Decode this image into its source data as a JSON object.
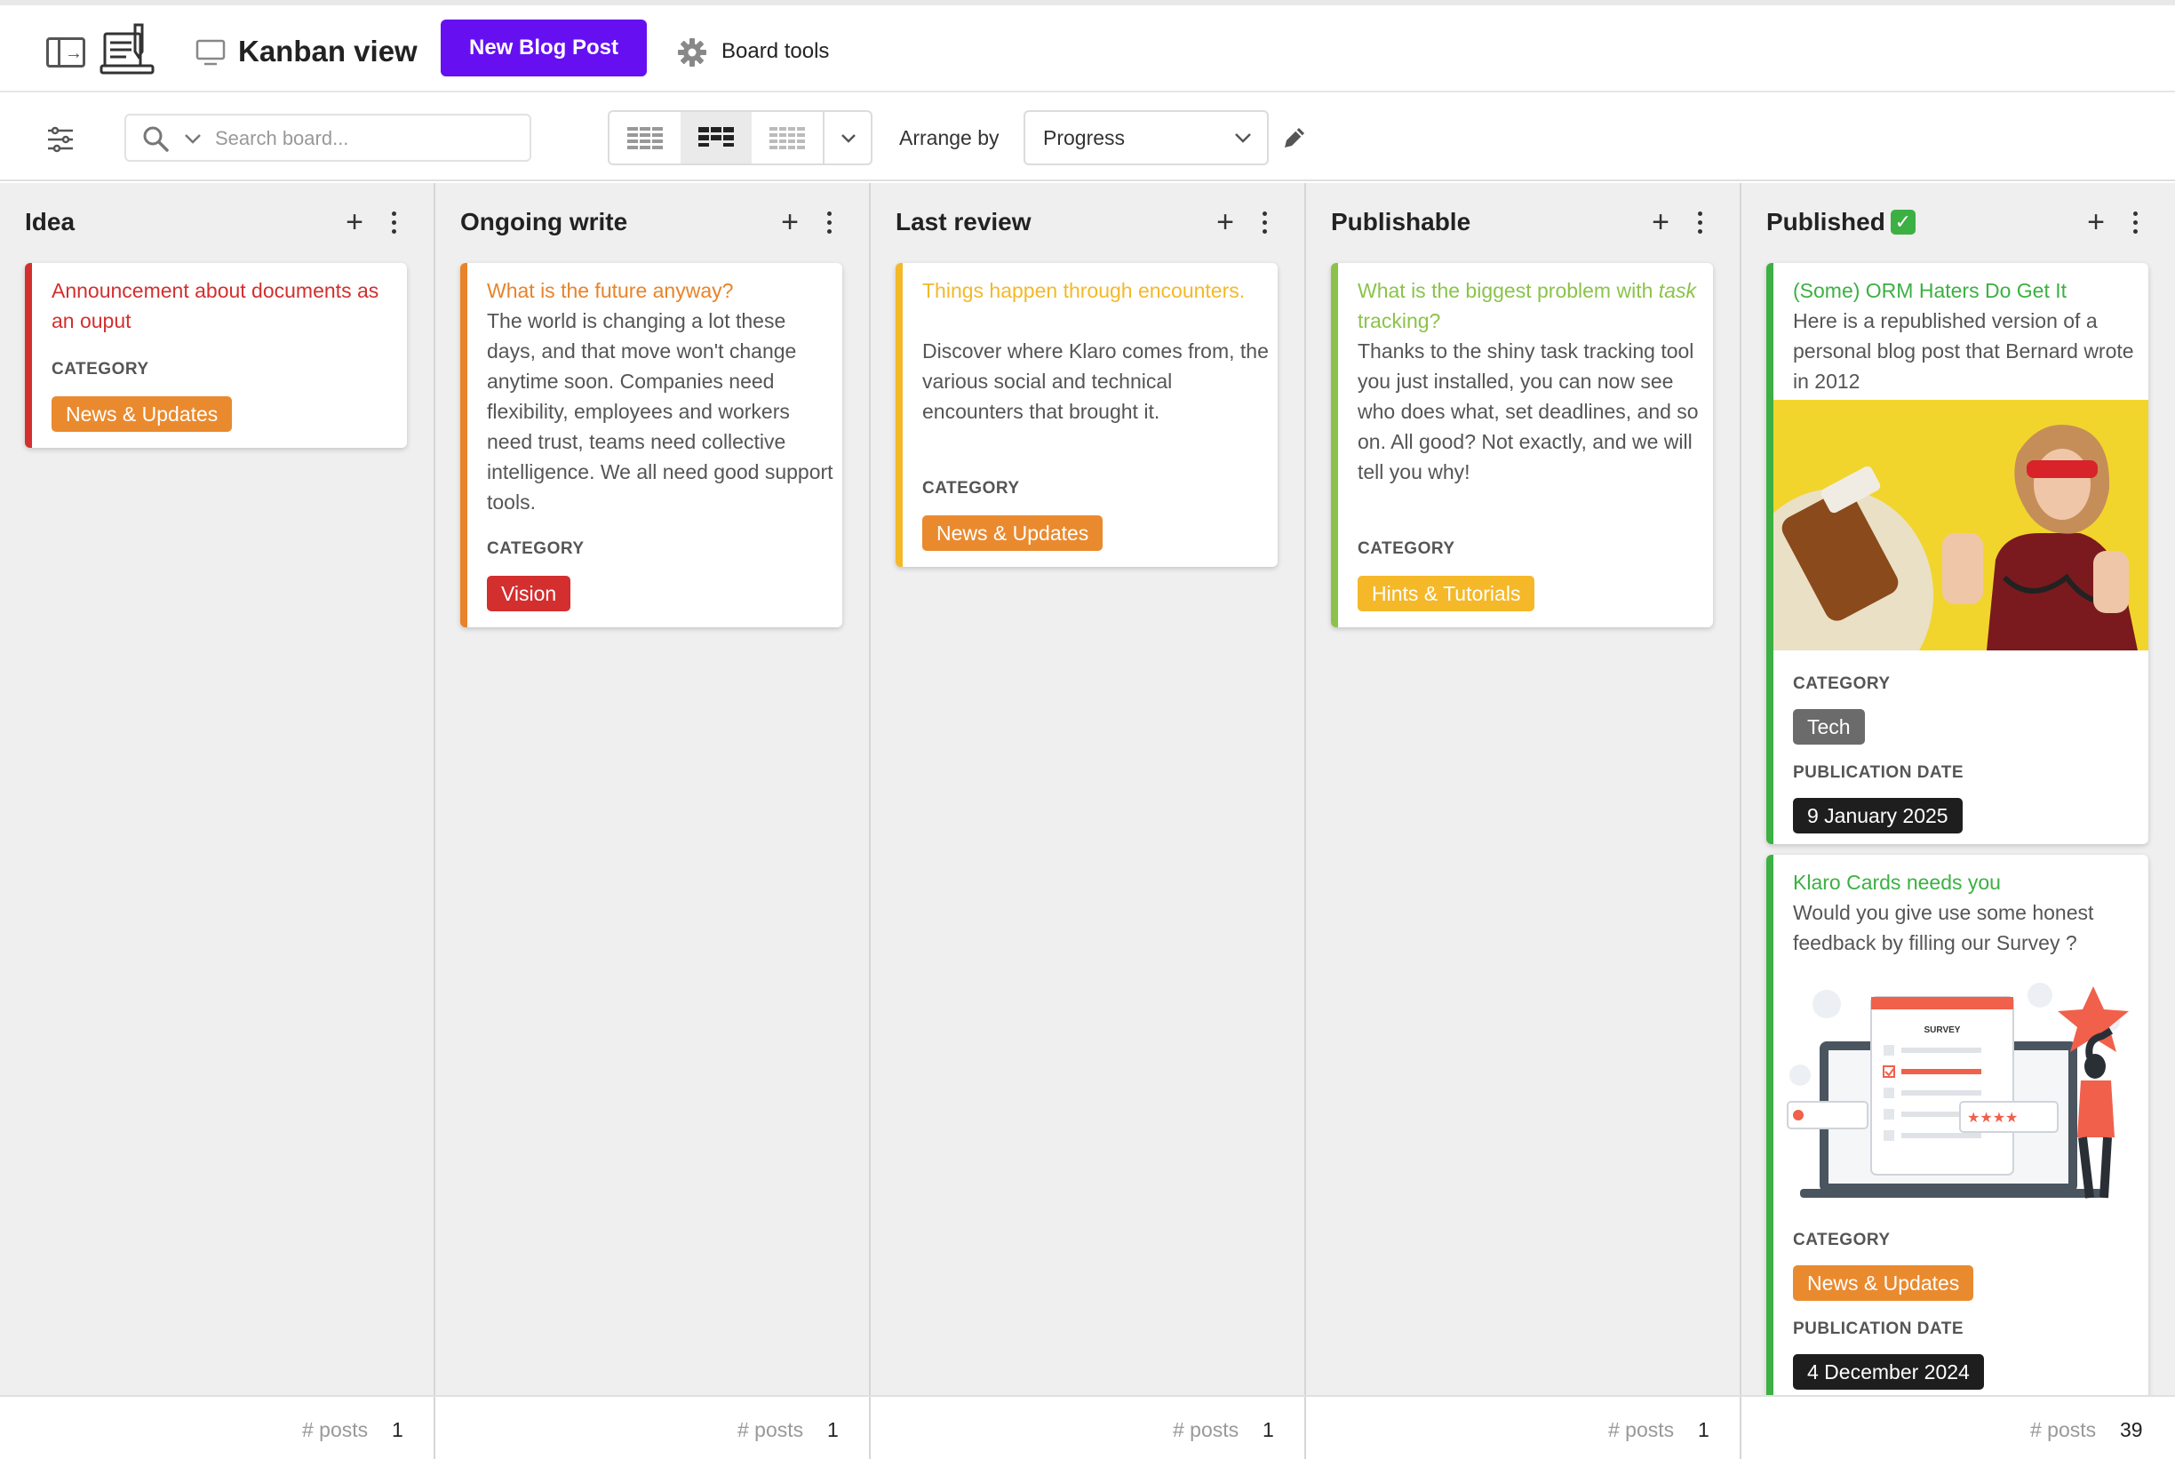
{
  "header": {
    "board_title": "Kanban view",
    "new_post_label": "New Blog Post",
    "board_tools_label": "Board tools"
  },
  "toolbar": {
    "search_placeholder": "Search board...",
    "arrange_label": "Arrange by",
    "arrange_value": "Progress"
  },
  "columns": [
    {
      "title": "Idea",
      "footer_label": "# posts",
      "footer_count": "1",
      "cards": [
        {
          "title": "Announcement about documents as an ouput",
          "category_label": "CATEGORY",
          "category": "News & Updates"
        }
      ]
    },
    {
      "title": "Ongoing write",
      "footer_label": "# posts",
      "footer_count": "1",
      "cards": [
        {
          "title": "What is the future anyway?",
          "description": "The world is changing a lot these days, and that move won't change anytime soon. Companies need flexibility, employees and workers need trust, teams need collective intelligence. We all need good support tools.",
          "category_label": "CATEGORY",
          "category": "Vision"
        }
      ]
    },
    {
      "title": "Last review",
      "footer_label": "# posts",
      "footer_count": "1",
      "cards": [
        {
          "title": "Things happen through encounters.",
          "description": "Discover where Klaro comes from, the various social and technical encounters that brought it.",
          "category_label": "CATEGORY",
          "category": "News & Updates"
        }
      ]
    },
    {
      "title": "Publishable",
      "footer_label": "# posts",
      "footer_count": "1",
      "cards": [
        {
          "title_prefix": "What is the biggest problem with ",
          "title_emph": "task",
          "title_suffix": " tracking?",
          "description": "Thanks to the shiny task tracking tool you just installed, you can now see who does what, set deadlines, and so on. All good? Not exactly, and we will tell you why!",
          "category_label": "CATEGORY",
          "category": "Hints & Tutorials"
        }
      ]
    },
    {
      "title": "Published",
      "title_badge": "✓",
      "footer_label": "# posts",
      "footer_count": "39",
      "cards": [
        {
          "title": "(Some) ORM Haters Do Get It",
          "description": "Here is a republished version of a personal blog post that Bernard wrote in 2012",
          "category_label": "CATEGORY",
          "category": "Tech",
          "date_label": "PUBLICATION DATE",
          "date": "9 January 2025"
        },
        {
          "title": "Klaro Cards needs you",
          "description": "Would you give use some honest feedback by filling our Survey ?",
          "survey_heading": "SURVEY",
          "category_label": "CATEGORY",
          "category": "News & Updates",
          "date_label": "PUBLICATION DATE",
          "date": "4 December 2024"
        }
      ]
    }
  ],
  "colors": {
    "primary": "#6610f2",
    "idea": "#d32f2f",
    "ongoing": "#e8832a",
    "review": "#f4b829",
    "publishable": "#8bc34a",
    "published": "#3cb043",
    "tag_news": "#ea8a2e",
    "tag_vision": "#d32f2f",
    "tag_hints": "#f4b829",
    "tag_tech": "#6b6b6b",
    "tag_date": "#1e1e1e"
  },
  "icons": [
    "sidebar-toggle-icon",
    "app-logo-icon",
    "board-view-icon",
    "gear-icon",
    "filter-icon",
    "search-icon",
    "chevron-down-icon",
    "pencil-icon",
    "plus-icon",
    "more-vertical-icon"
  ]
}
